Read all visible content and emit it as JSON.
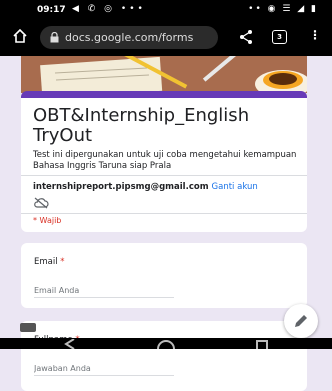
{
  "status_bar": {
    "time": "09:17",
    "left_icons": "◀ ✆ ◎ •••",
    "right_icons": "•• ◉ ☰ ◢ ▮"
  },
  "browser": {
    "url": "docs.google.com/forms",
    "tab_count": "3"
  },
  "form": {
    "title": "OBT&Internship_English TryOut",
    "description": "Test ini dipergunakan untuk uji coba mengetahui kemampuan Bahasa Inggris Taruna siap Prala",
    "account_email": "internshipreport.pipsmg@gmail.com",
    "switch_account": "Ganti akun",
    "required_note": "* Wajib",
    "accent_color": "#673ab7",
    "required_color": "#d93025"
  },
  "questions": [
    {
      "label": "Email",
      "required_mark": "*",
      "placeholder": "Email Anda"
    },
    {
      "label": "Fullname",
      "required_mark": "*",
      "placeholder": "Jawaban Anda"
    }
  ]
}
